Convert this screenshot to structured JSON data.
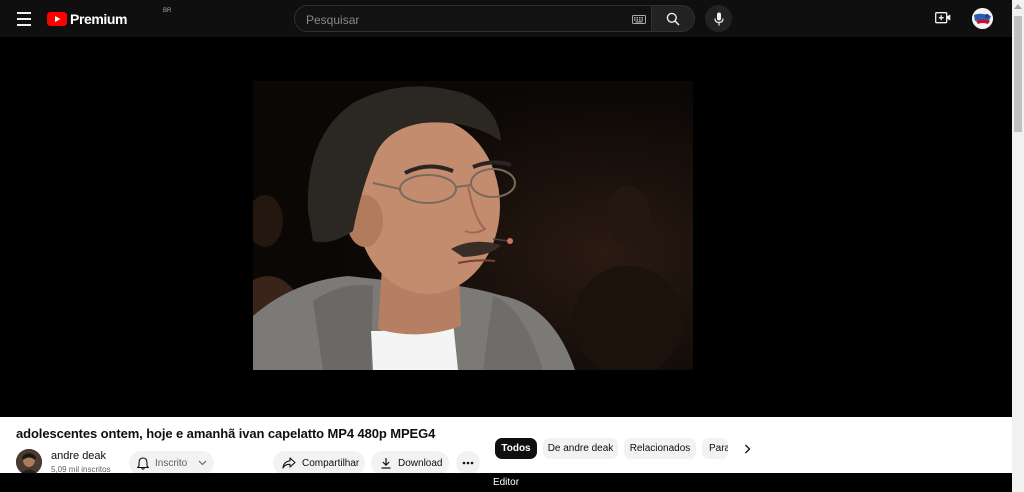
{
  "header": {
    "logo_text": "Premium",
    "logo_country": "BR",
    "search_placeholder": "Pesquisar"
  },
  "video": {
    "title": "adolescentes ontem, hoje e amanhã ivan capelatto MP4 480p MPEG4"
  },
  "channel": {
    "name": "andre deak",
    "subscribers": "5,09 mil inscritos"
  },
  "actions": {
    "subscribe_label": "Inscrito",
    "share_label": "Compartilhar",
    "download_label": "Download"
  },
  "chips": [
    {
      "label": "Todos",
      "active": true
    },
    {
      "label": "De andre deak",
      "active": false
    },
    {
      "label": "Relacionados",
      "active": false
    },
    {
      "label": "Para",
      "active": false
    }
  ],
  "footer": {
    "label": "Editor"
  },
  "colors": {
    "brand_red": "#ff0000",
    "topbar_bg": "#0f0f0f",
    "chip_active_bg": "#0f0f0f",
    "chip_bg": "#f2f2f2"
  },
  "icons": [
    "menu-icon",
    "youtube-logo-icon",
    "keyboard-icon",
    "search-icon",
    "microphone-icon",
    "create-video-icon",
    "bell-icon",
    "chevron-down-icon",
    "share-icon",
    "download-icon",
    "more-horizontal-icon",
    "chevron-right-icon"
  ]
}
